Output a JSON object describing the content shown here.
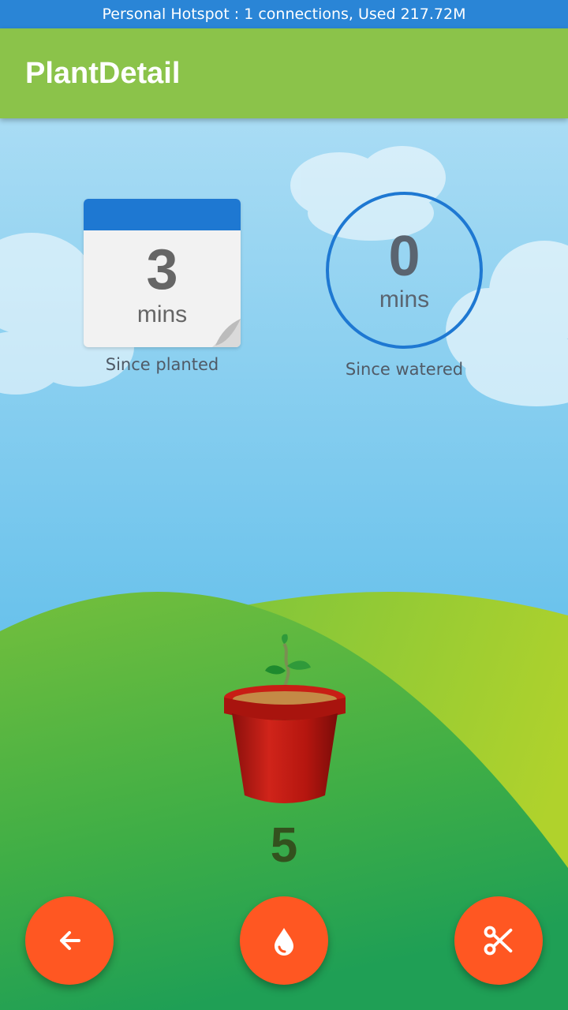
{
  "status_bar": {
    "text": "Personal Hotspot : 1 connections, Used 217.72M"
  },
  "app_bar": {
    "title": "PlantDetail"
  },
  "planted": {
    "value": "3",
    "unit": "mins",
    "label": "Since planted"
  },
  "watered": {
    "value": "0",
    "unit": "mins",
    "label": "Since watered"
  },
  "plant": {
    "count": "5"
  },
  "actions": [
    {
      "name": "back",
      "icon": "arrow-left-icon"
    },
    {
      "name": "water",
      "icon": "water-drop-icon"
    },
    {
      "name": "prune",
      "icon": "scissors-icon"
    }
  ],
  "colors": {
    "status_bar": "#2a85d6",
    "app_bar": "#8bc34a",
    "accent": "#1e78d2",
    "fab": "#ff5722",
    "pot": "#c41e14"
  }
}
